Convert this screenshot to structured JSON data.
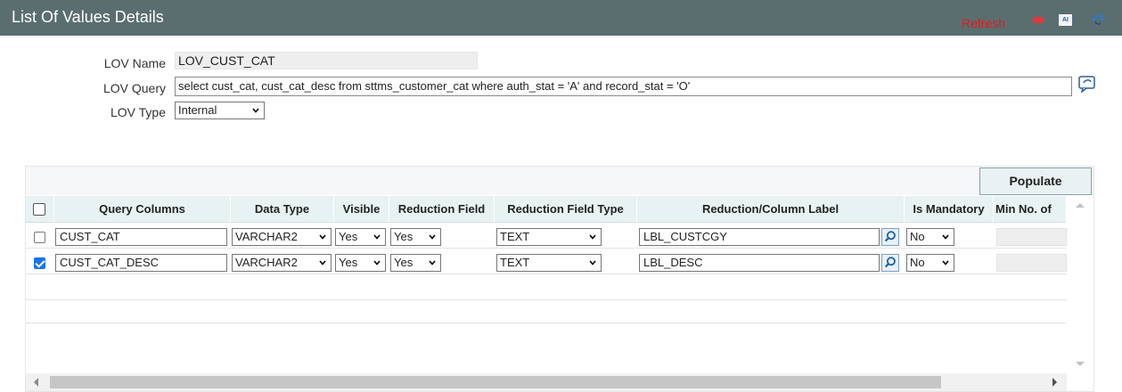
{
  "window": {
    "title": "List Of Values Details",
    "refresh_label": "Refresh",
    "export_icon_text": "AI",
    "icons": [
      "minimize-icon",
      "export-icon",
      "exit-icon"
    ],
    "colors": {
      "titlebar": "#5a6e6f",
      "refresh": "#e8181c",
      "header_row": "#e8f2f3",
      "checkbox_checked": "#1a73e8"
    }
  },
  "form": {
    "lov_name_label": "LOV Name",
    "lov_name_value": "LOV_CUST_CAT",
    "lov_query_label": "LOV Query",
    "lov_query_value": "select cust_cat, cust_cat_desc from sttms_customer_cat where auth_stat = 'A' and record_stat = 'O'",
    "lov_type_label": "LOV Type",
    "lov_type_value": "Internal"
  },
  "grid": {
    "populate_label": "Populate",
    "headers": {
      "query_columns": "Query Columns",
      "data_type": "Data Type",
      "visible": "Visible",
      "reduction_field": "Reduction Field",
      "reduction_field_type": "Reduction Field Type",
      "reduction_column_label": "Reduction/Column Label",
      "is_mandatory": "Is Mandatory",
      "min_no_of": "Min No. of"
    },
    "rows": [
      {
        "checked": false,
        "query_column": "CUST_CAT",
        "data_type": "VARCHAR2",
        "visible": "Yes",
        "reduction_field": "Yes",
        "reduction_field_type": "TEXT",
        "column_label": "LBL_CUSTCGY",
        "is_mandatory": "No"
      },
      {
        "checked": true,
        "query_column": "CUST_CAT_DESC",
        "data_type": "VARCHAR2",
        "visible": "Yes",
        "reduction_field": "Yes",
        "reduction_field_type": "TEXT",
        "column_label": "LBL_DESC",
        "is_mandatory": "No"
      }
    ]
  }
}
